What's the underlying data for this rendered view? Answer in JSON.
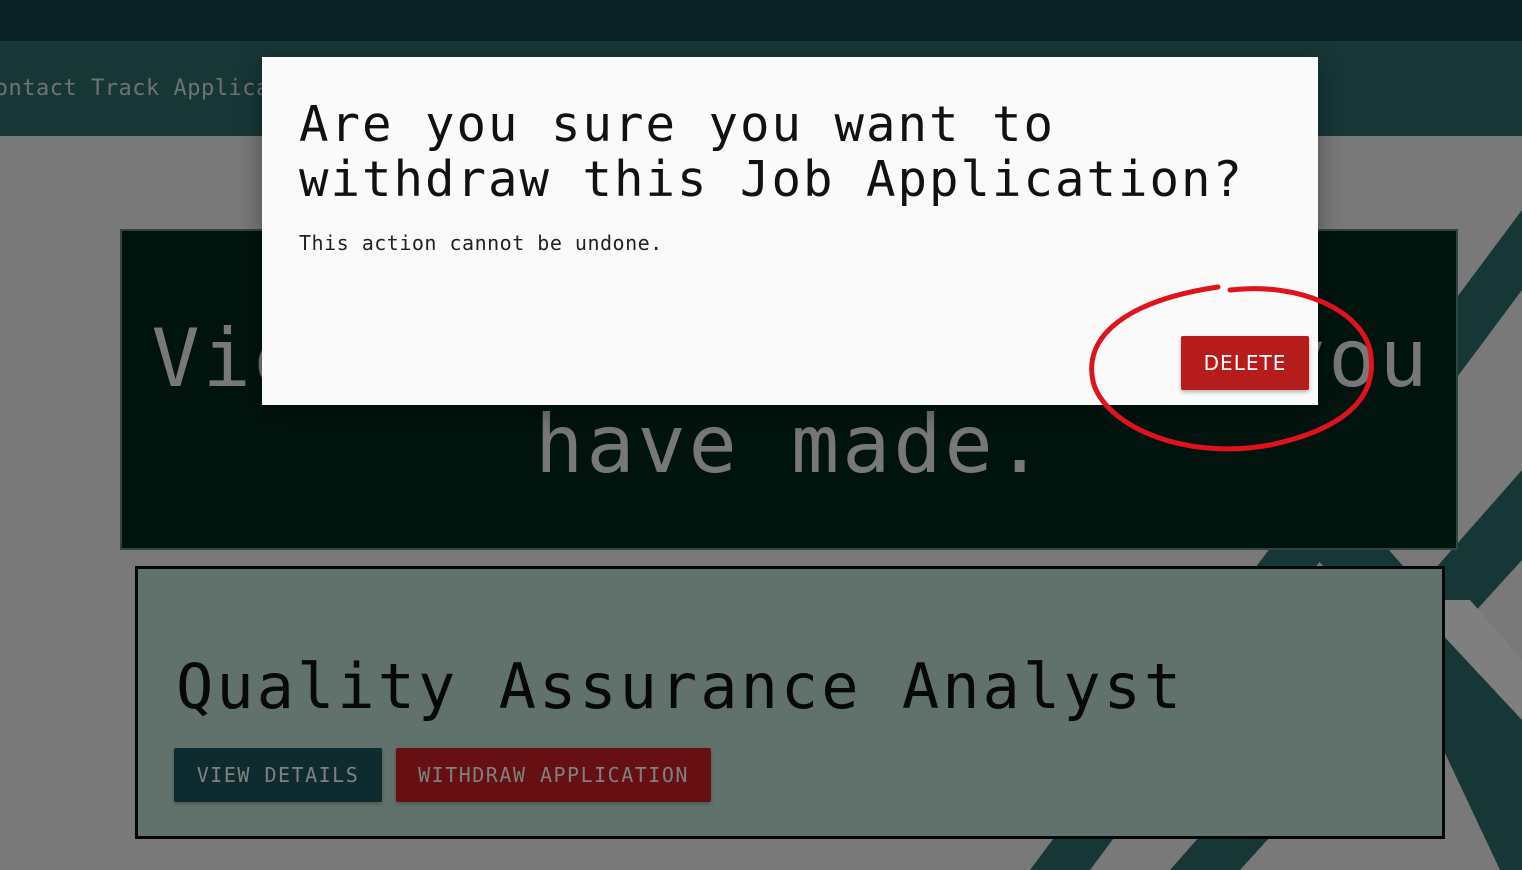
{
  "nav": {
    "items": [
      "Contact",
      "Track Applications"
    ]
  },
  "hero": {
    "text": "View the applications you have made."
  },
  "job": {
    "title": "Quality Assurance Analyst",
    "view_label": "VIEW DETAILS",
    "withdraw_label": "WITHDRAW APPLICATION"
  },
  "dialog": {
    "title": "Are you sure you want to withdraw this Job Application?",
    "body": "This action cannot be undone.",
    "delete_label": "DELETE"
  },
  "colors": {
    "nav": "#2e6d6c",
    "hero": "#00291a",
    "card": "#c3e2d6",
    "danger": "#b71c1c",
    "primary": "#1c5961",
    "annotation": "#e0121b"
  }
}
